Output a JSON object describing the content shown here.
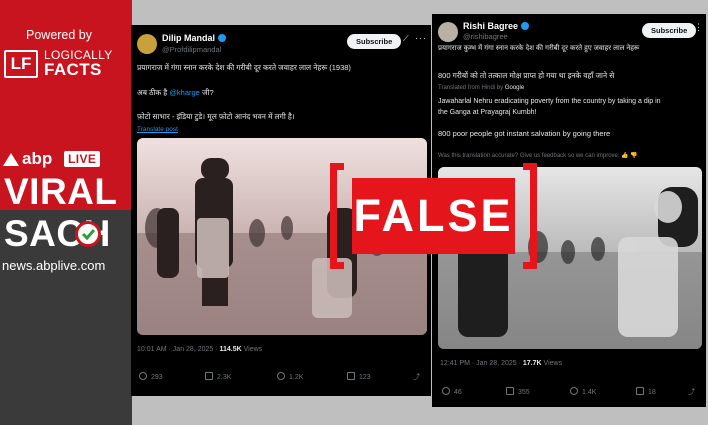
{
  "brand": {
    "powered_by": "Powered by",
    "lf_mark": "LF",
    "lf_name_top": "LOGICALLY",
    "lf_name_bottom": "FACTS",
    "abp": "abp",
    "live": "LIVE",
    "viral": "VIRAL",
    "sach": "SACH",
    "domain": "news.abplive.com",
    "colors": {
      "red": "#c8141e",
      "dark": "#3a3a3a",
      "stamp": "#e4161c",
      "link": "#1d9bf0"
    }
  },
  "stamp": {
    "label": "FALSE"
  },
  "tweet_left": {
    "user": "Dilip Mandal",
    "handle": "@Profdilipmandal",
    "subscribe": "Subscribe",
    "grok_icon": "grok-icon",
    "line1": "प्रयागराज में गंगा स्नान करके देश की गरीबी दूर करते जवाहर लाल नेहरू (1938)",
    "line2_prefix": "अब ठीक है ",
    "line2_mention": "@kharge",
    "line2_suffix": " जी?",
    "line3": "फ़ोटो साभार - इंडिया टुडे। मूल फ़ोटो आनंद भवन में लगी है।",
    "translate": "Translate post",
    "time": "10:01 AM · Jan 28, 2025 · ",
    "views_count": "114.5K",
    "views_label": " Views",
    "actions": {
      "reply": "293",
      "repost": "2.3K",
      "like": "1.2K",
      "bookmark": "123"
    }
  },
  "tweet_right": {
    "user": "Rishi Bagree",
    "handle": "@rishibagree",
    "subscribe": "Subscribe",
    "line1": "प्रयागराज कुम्भ में गंगा स्नान करके देश की गरीबी दूर करते हुए जवाहर लाल नेहरू",
    "line2": "800 गरीबों को तो तत्काल मोक्ष प्राप्त हो गया था इनके वहाँ जाने से",
    "translated_from": "Translated from Hindi by ",
    "translated_by": "Google",
    "trans1": "Jawaharlal Nehru eradicating poverty from the country by taking a dip in",
    "trans2": "the Ganga at Prayagraj Kumbh!",
    "trans3": "800 poor people got instant salvation by going there",
    "feedback": "Was this translation accurate? Give us feedback so we can improve:",
    "time": "12:41 PM · Jan 28, 2025 · ",
    "views_count": "17.7K",
    "views_label": " Views",
    "actions": {
      "reply": "46",
      "repost": "355",
      "like": "1.4K",
      "bookmark": "18"
    }
  }
}
